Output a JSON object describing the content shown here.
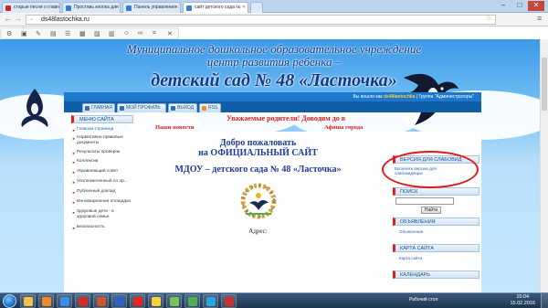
{
  "browser": {
    "tabs": [
      {
        "label": "старые песни о главн",
        "color": "#cc2a2a"
      },
      {
        "label": "Проставь кнопка для",
        "color": "#3c7bd6"
      },
      {
        "label": "Панель управления :",
        "color": "#3c7bd6"
      },
      {
        "label": "сайт детского сада №",
        "color": "#3c7bd6"
      }
    ],
    "url": "ds48lastochka.ru",
    "window_controls": [
      "–",
      "□",
      "✕"
    ]
  },
  "site": {
    "header_line1": "Муниципальное дошкольное образовательное учреждение",
    "header_line2": "центр развития ребенка –",
    "header_line3": "детский сад № 48 «Ласточка»",
    "user_bar": {
      "prefix": "Вы вошли как",
      "username": "ds48lastochka",
      "group": "| Группа \"Администраторы\""
    },
    "nav": [
      "ГЛАВНАЯ",
      "МОЙ ПРОФИЛЬ",
      "ВЫХОД",
      "RSS"
    ],
    "left_menu": {
      "header": "МЕНЮ САЙТА",
      "items": [
        "Главная страница",
        "Нормативно-правовые документы",
        "Результаты проверок",
        "Коллектив",
        "Управляющий совет",
        "Уполномоченный по пр...",
        "Публичный доклад",
        "Инновационная площадка",
        "Здоровые дети - в здоровой семье",
        "Безопасность"
      ]
    },
    "marquee": "Уважаемые родители! Доводим до в",
    "sections": {
      "news": "Наши новости",
      "poster": "Афиша города"
    },
    "welcome_line1": "Добро пожаловать",
    "welcome_line2": "на ОФИЦИАЛЬНЫЙ САЙТ",
    "welcome_line3": "МДОУ – детского сада № 48 «Ласточка»",
    "address_label": "Адрес:",
    "right": {
      "accessibility_header": "ВЕРСИЯ ДЛЯ СЛАБОВИД",
      "accessibility_link": "Включить версию для слабовидящих",
      "search_header": "ПОИСК",
      "search_button": "Найти",
      "ads_header": "ОБЪЯВЛЕНИЯ",
      "ads_link": "Объявления",
      "map_header": "КАРТА САЙТА",
      "map_link": "Карта сайта",
      "calendar_header": "КАЛЕНДАРЬ"
    }
  },
  "taskbar": {
    "desktop_label": "Рабочий стол",
    "time": "15:04",
    "date": "15.02.2016",
    "apps": [
      {
        "icon": "explorer-icon",
        "color": "#f3c24a"
      },
      {
        "icon": "media-player-icon",
        "color": "#f08a24"
      },
      {
        "icon": "ie-icon",
        "color": "#3a8ee6"
      },
      {
        "icon": "opera-icon",
        "color": "#d12b2b"
      },
      {
        "icon": "powerpoint-icon",
        "color": "#d0552a"
      },
      {
        "icon": "word-icon",
        "color": "#2b62c4"
      },
      {
        "icon": "yandex-icon",
        "color": "#e82323"
      },
      {
        "icon": "yandex-browser-icon",
        "color": "#f5d33a"
      },
      {
        "icon": "paint-icon",
        "color": "#78c35c"
      },
      {
        "icon": "chrome-icon",
        "color": "#4caf50"
      },
      {
        "icon": "skype-icon",
        "color": "#2aa5e0"
      },
      {
        "icon": "pdf-icon",
        "color": "#c93030"
      }
    ]
  }
}
